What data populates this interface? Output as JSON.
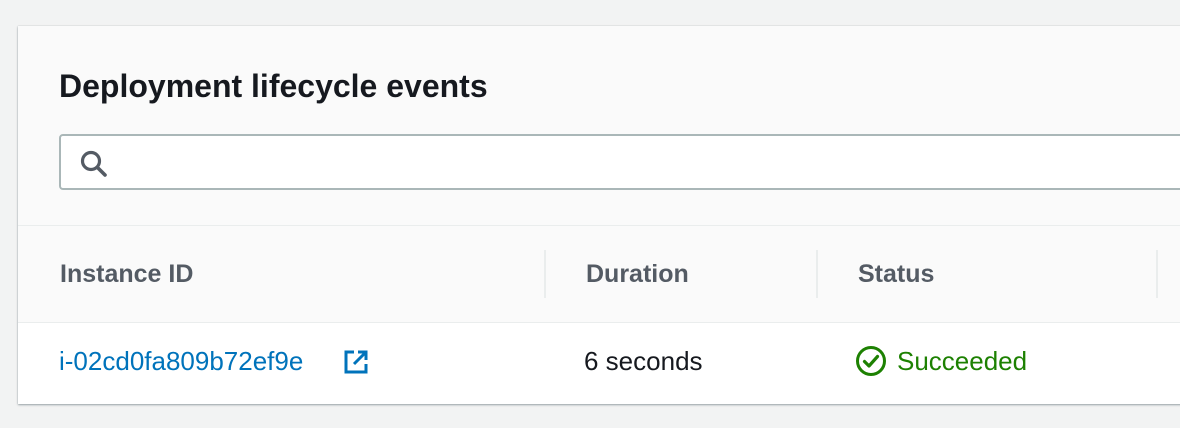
{
  "panel": {
    "title": "Deployment lifecycle events"
  },
  "search": {
    "icon": "search-icon",
    "value": "",
    "placeholder": ""
  },
  "table": {
    "columns": [
      "Instance ID",
      "Duration",
      "Status"
    ],
    "rows": [
      {
        "instance_id": "i-02cd0fa809b72ef9e",
        "instance_icon": "external-link-icon",
        "duration": "6 seconds",
        "status": "Succeeded",
        "status_icon": "check-circle-icon"
      }
    ]
  },
  "colors": {
    "link": "#0073bb",
    "success": "#1d8102",
    "heading": "#16191f",
    "column_header": "#545b64"
  }
}
